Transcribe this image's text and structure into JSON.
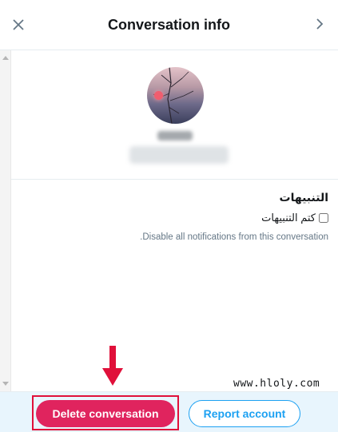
{
  "header": {
    "title": "Conversation info",
    "close_icon": "close-icon",
    "next_icon": "chevron-right-icon"
  },
  "profile": {
    "avatar_icon": "avatar"
  },
  "notifications": {
    "title": "التنبيهات",
    "mute_label": "كتم التنبيهات",
    "mute_checked": false,
    "description": "Disable all notifications from this conversation."
  },
  "watermark": "www.hloly.com",
  "footer": {
    "delete_label": "Delete conversation",
    "report_label": "Report account"
  },
  "colors": {
    "delete_bg": "#e0245e",
    "report_accent": "#1da1f2",
    "footer_bg": "#e8f5fd",
    "annotation_red": "#e0103a"
  }
}
